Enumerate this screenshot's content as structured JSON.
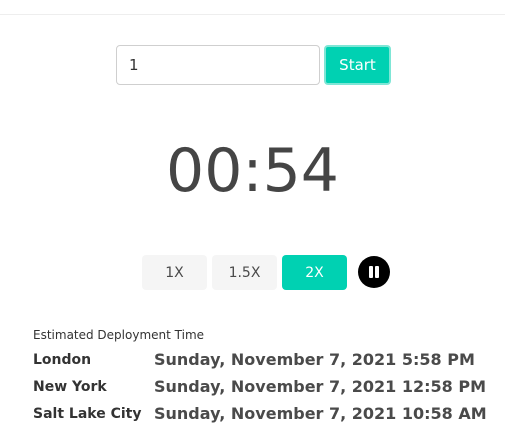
{
  "timer_form": {
    "minutes_value": "1",
    "start_label": "Start"
  },
  "countdown": {
    "display": "00:54"
  },
  "speed_controls": {
    "options": [
      "1X",
      "1.5X",
      "2X"
    ],
    "selected": "2X"
  },
  "pause": {
    "icon": "pause-icon"
  },
  "deployment": {
    "label": "Estimated Deployment Time",
    "rows": [
      {
        "city": "London",
        "time": "Sunday, November 7, 2021 5:58 PM"
      },
      {
        "city": "New York",
        "time": "Sunday, November 7, 2021 12:58 PM"
      },
      {
        "city": "Salt Lake City",
        "time": "Sunday, November 7, 2021 10:58 AM"
      }
    ]
  },
  "colors": {
    "accent": "#00d1b2",
    "button_bg": "#f5f5f5",
    "timer_text": "#454545"
  }
}
